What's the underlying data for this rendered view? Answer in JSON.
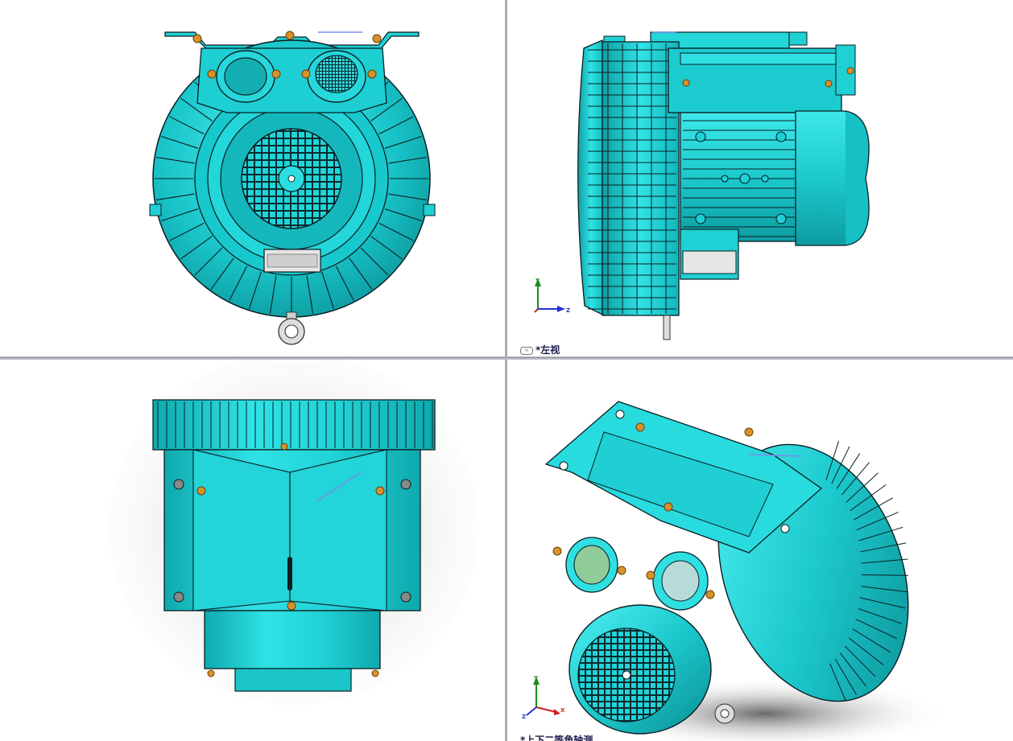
{
  "views": {
    "front": {
      "label": ""
    },
    "left": {
      "label": "*左视",
      "icon": "view-chip-icon"
    },
    "top": {
      "label": ""
    },
    "iso": {
      "label": "*上下二等角轴测"
    }
  },
  "triad": {
    "x": "X",
    "y": "Y",
    "z": "Z"
  },
  "colors": {
    "body": "#10bcc0",
    "highlight": "#3fe9ec",
    "edge": "#0b1e22",
    "brass": "#d8922a",
    "background": "#ffffff"
  }
}
